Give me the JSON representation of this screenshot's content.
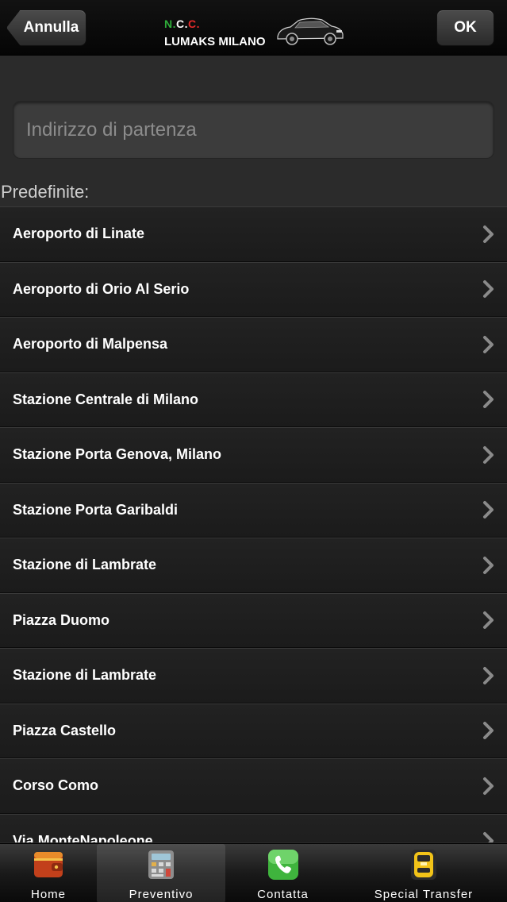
{
  "navbar": {
    "back_label": "Annulla",
    "ok_label": "OK",
    "logo": {
      "ncc_n": "N",
      "ncc_dot1": ".",
      "ncc_c1": "C",
      "ncc_dot2": ".",
      "ncc_c2": "C",
      "ncc_dot3": ".",
      "name": "LUMAKS MILANO"
    }
  },
  "form": {
    "address_placeholder": "Indirizzo di partenza",
    "address_value": ""
  },
  "presets": {
    "heading": "Predefinite:",
    "items": [
      {
        "label": "Aeroporto di Linate"
      },
      {
        "label": "Aeroporto di Orio Al Serio"
      },
      {
        "label": "Aeroporto di Malpensa"
      },
      {
        "label": "Stazione Centrale di Milano"
      },
      {
        "label": "Stazione Porta Genova, Milano"
      },
      {
        "label": "Stazione Porta Garibaldi"
      },
      {
        "label": "Stazione di Lambrate"
      },
      {
        "label": "Piazza Duomo"
      },
      {
        "label": "Stazione di Lambrate"
      },
      {
        "label": "Piazza Castello"
      },
      {
        "label": "Corso Como"
      },
      {
        "label": "Via MonteNapoleone"
      }
    ]
  },
  "tabbar": {
    "tabs": [
      {
        "label": "Home",
        "icon": "wallet-icon"
      },
      {
        "label": "Preventivo",
        "icon": "calculator-icon"
      },
      {
        "label": "Contatta",
        "icon": "phone-icon"
      },
      {
        "label": "Special Transfer",
        "icon": "taxi-icon"
      }
    ],
    "active_index": 1
  },
  "colors": {
    "background": "#2b2b2b",
    "navbar": "#0a0a0a",
    "list_row": "#1f1f1f",
    "ncc_green": "#2fae3a",
    "ncc_red": "#e42a2a"
  }
}
